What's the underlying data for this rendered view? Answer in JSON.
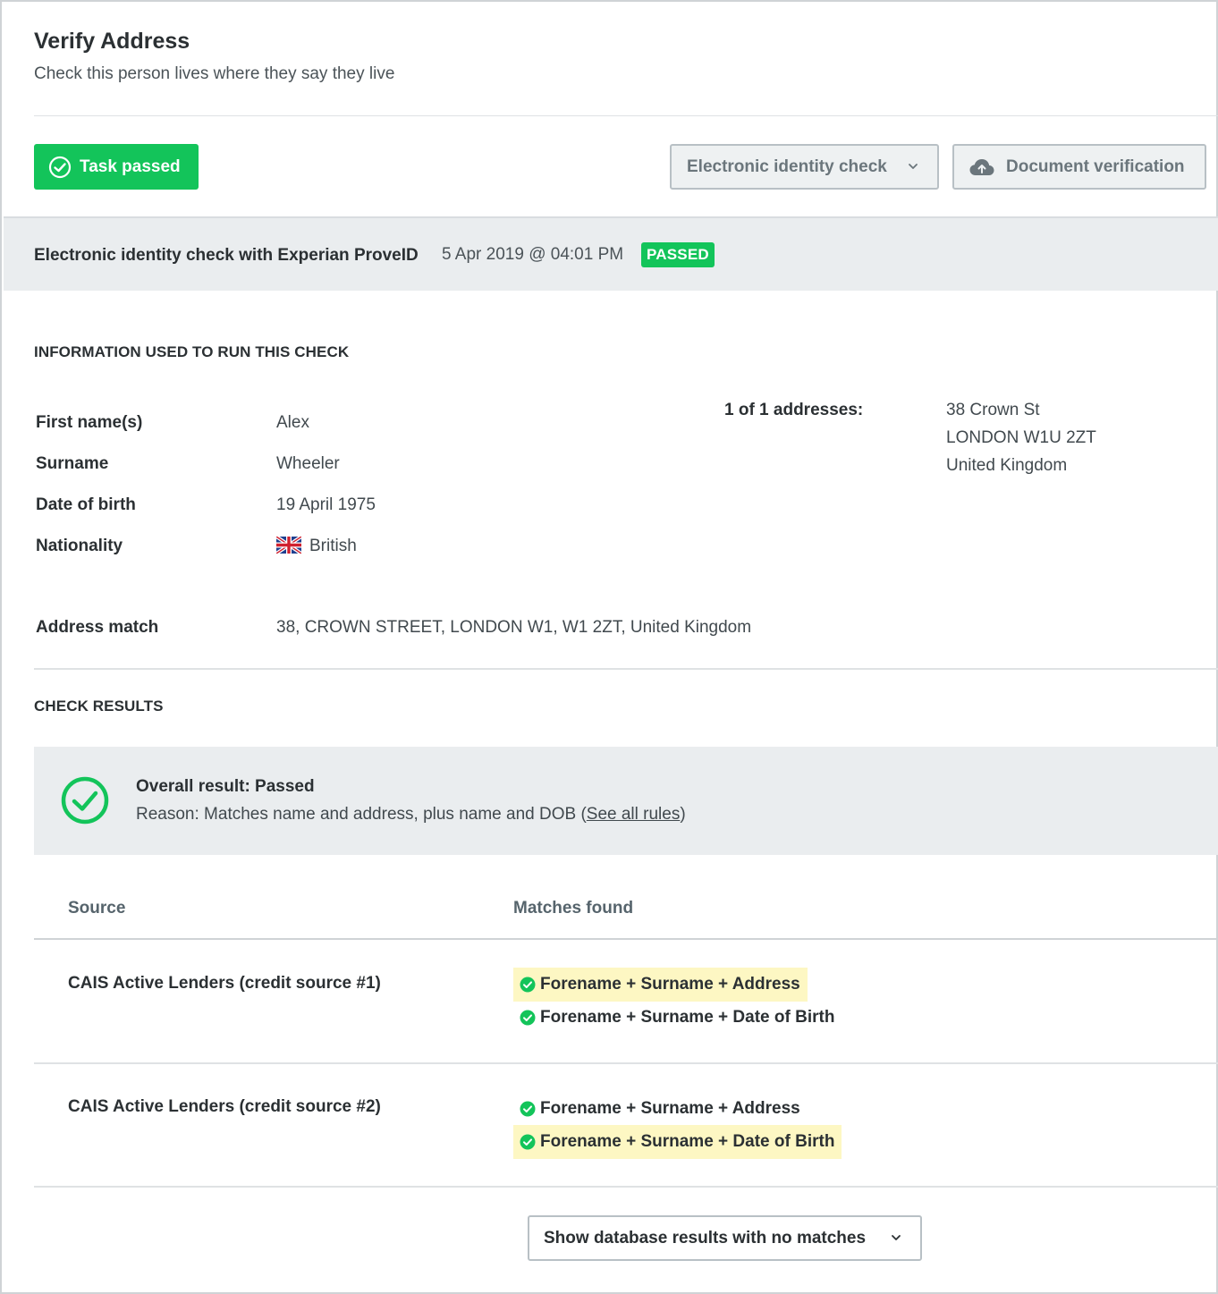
{
  "header": {
    "title": "Verify Address",
    "subtitle": "Check this person lives where they say they live"
  },
  "toolbar": {
    "task_status_label": "Task passed",
    "eic_dropdown_label": "Electronic identity check",
    "doc_verification_label": "Document verification"
  },
  "check": {
    "title": "Electronic identity check with Experian ProveID",
    "datetime": "5 Apr 2019 @ 04:01 PM",
    "status_badge": "PASSED"
  },
  "info": {
    "heading": "INFORMATION USED TO RUN THIS CHECK",
    "fields": [
      {
        "label": "First name(s)",
        "value": "Alex"
      },
      {
        "label": "Surname",
        "value": "Wheeler"
      },
      {
        "label": "Date of birth",
        "value": "19 April 1975"
      },
      {
        "label": "Nationality",
        "value": "British"
      }
    ],
    "address_label": "1 of 1 addresses:",
    "address_lines": [
      "38 Crown St",
      "LONDON W1U 2ZT",
      "United Kingdom"
    ],
    "address_match_label": "Address match",
    "address_match_value": "38, CROWN STREET, LONDON W1, W1 2ZT, United Kingdom"
  },
  "results": {
    "heading": "CHECK RESULTS",
    "overall_title": "Overall result: Passed",
    "reason_prefix": "Reason: Matches name and address, plus name and DOB (",
    "see_all_rules": "See all rules",
    "reason_suffix": ")",
    "col_source": "Source",
    "col_matches": "Matches found",
    "rows": [
      {
        "source": "CAIS Active Lenders (credit source #1)",
        "matches": [
          "Forename + Surname + Address",
          "Forename + Surname + Date of Birth"
        ]
      },
      {
        "source": "CAIS Active Lenders (credit source #2)",
        "matches": [
          "Forename + Surname + Address",
          "Forename + Surname + Date of Birth"
        ]
      }
    ],
    "show_no_matches_label": "Show database results with no matches"
  },
  "colors": {
    "success": "#13c45a",
    "highlight": "#fdf7c3",
    "band": "#eaedef"
  },
  "icons": {
    "task_status": "check-circle-icon",
    "eic_dropdown": "chevron-down-icon",
    "doc_verification": "cloud-upload-icon",
    "nationality": "uk-flag-icon",
    "overall_result": "check-circle-icon",
    "match": "check-circle-filled-icon"
  }
}
